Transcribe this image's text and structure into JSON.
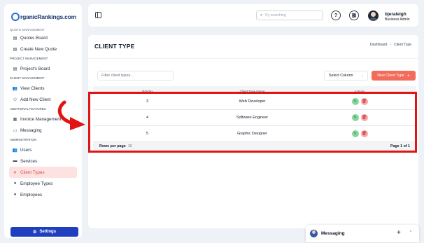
{
  "brand": {
    "logo_text": "rganicRankings.com"
  },
  "sidebar": {
    "cut_section": "Quote Management",
    "items_quotes": [
      {
        "label": "Quotes Board",
        "icon": "board-icon"
      },
      {
        "label": "Create New Quote",
        "icon": "board-icon"
      }
    ],
    "sec_project": "Project Management",
    "items_project": [
      {
        "label": "Project's Board",
        "icon": "board-icon"
      }
    ],
    "sec_client": "Client Management",
    "items_client": [
      {
        "label": "View Clients",
        "icon": "users-icon"
      },
      {
        "label": "Add New Client",
        "icon": "user-plus-icon"
      }
    ],
    "sec_additional": "Additional Features",
    "items_additional": [
      {
        "label": "Invoice Management",
        "icon": "invoice-icon"
      },
      {
        "label": "Messaging",
        "icon": "chat-icon"
      }
    ],
    "sec_admin": "Administration",
    "items_admin": [
      {
        "label": "Users",
        "icon": "users-icon"
      },
      {
        "label": "Services",
        "icon": "briefcase-icon"
      },
      {
        "label": "Client Types",
        "icon": "close-icon",
        "active": true
      },
      {
        "label": "Employee Types",
        "icon": "person-icon"
      },
      {
        "label": "Employees",
        "icon": "person-icon"
      }
    ],
    "settings_label": "Settings"
  },
  "topbar": {
    "search_placeholder": "Try searching",
    "user_name": "bjeraleigh",
    "user_role": "Business Admin"
  },
  "page": {
    "title": "CLIENT TYPE",
    "breadcrumb": [
      "Dashboard",
      "Client Type"
    ]
  },
  "toolbar": {
    "filter_placeholder": "Filter client types...",
    "select_column": "Select Column",
    "new_button": "New Client Type"
  },
  "table": {
    "columns": [
      "Id/Index",
      "Client Type Name",
      "Actions"
    ],
    "rows": [
      {
        "id": "3",
        "name": "Web Developer"
      },
      {
        "id": "4",
        "name": "Software Engineer"
      },
      {
        "id": "5",
        "name": "Graphic Designer"
      }
    ],
    "rows_per_page_label": "Rows per page",
    "rows_per_page_value": "10",
    "page_label": "Page 1 of 1"
  },
  "messaging": {
    "label": "Messaging"
  },
  "colors": {
    "accent": "#f26b5b",
    "primary": "#1f3fbf",
    "highlight": "#e11414"
  }
}
